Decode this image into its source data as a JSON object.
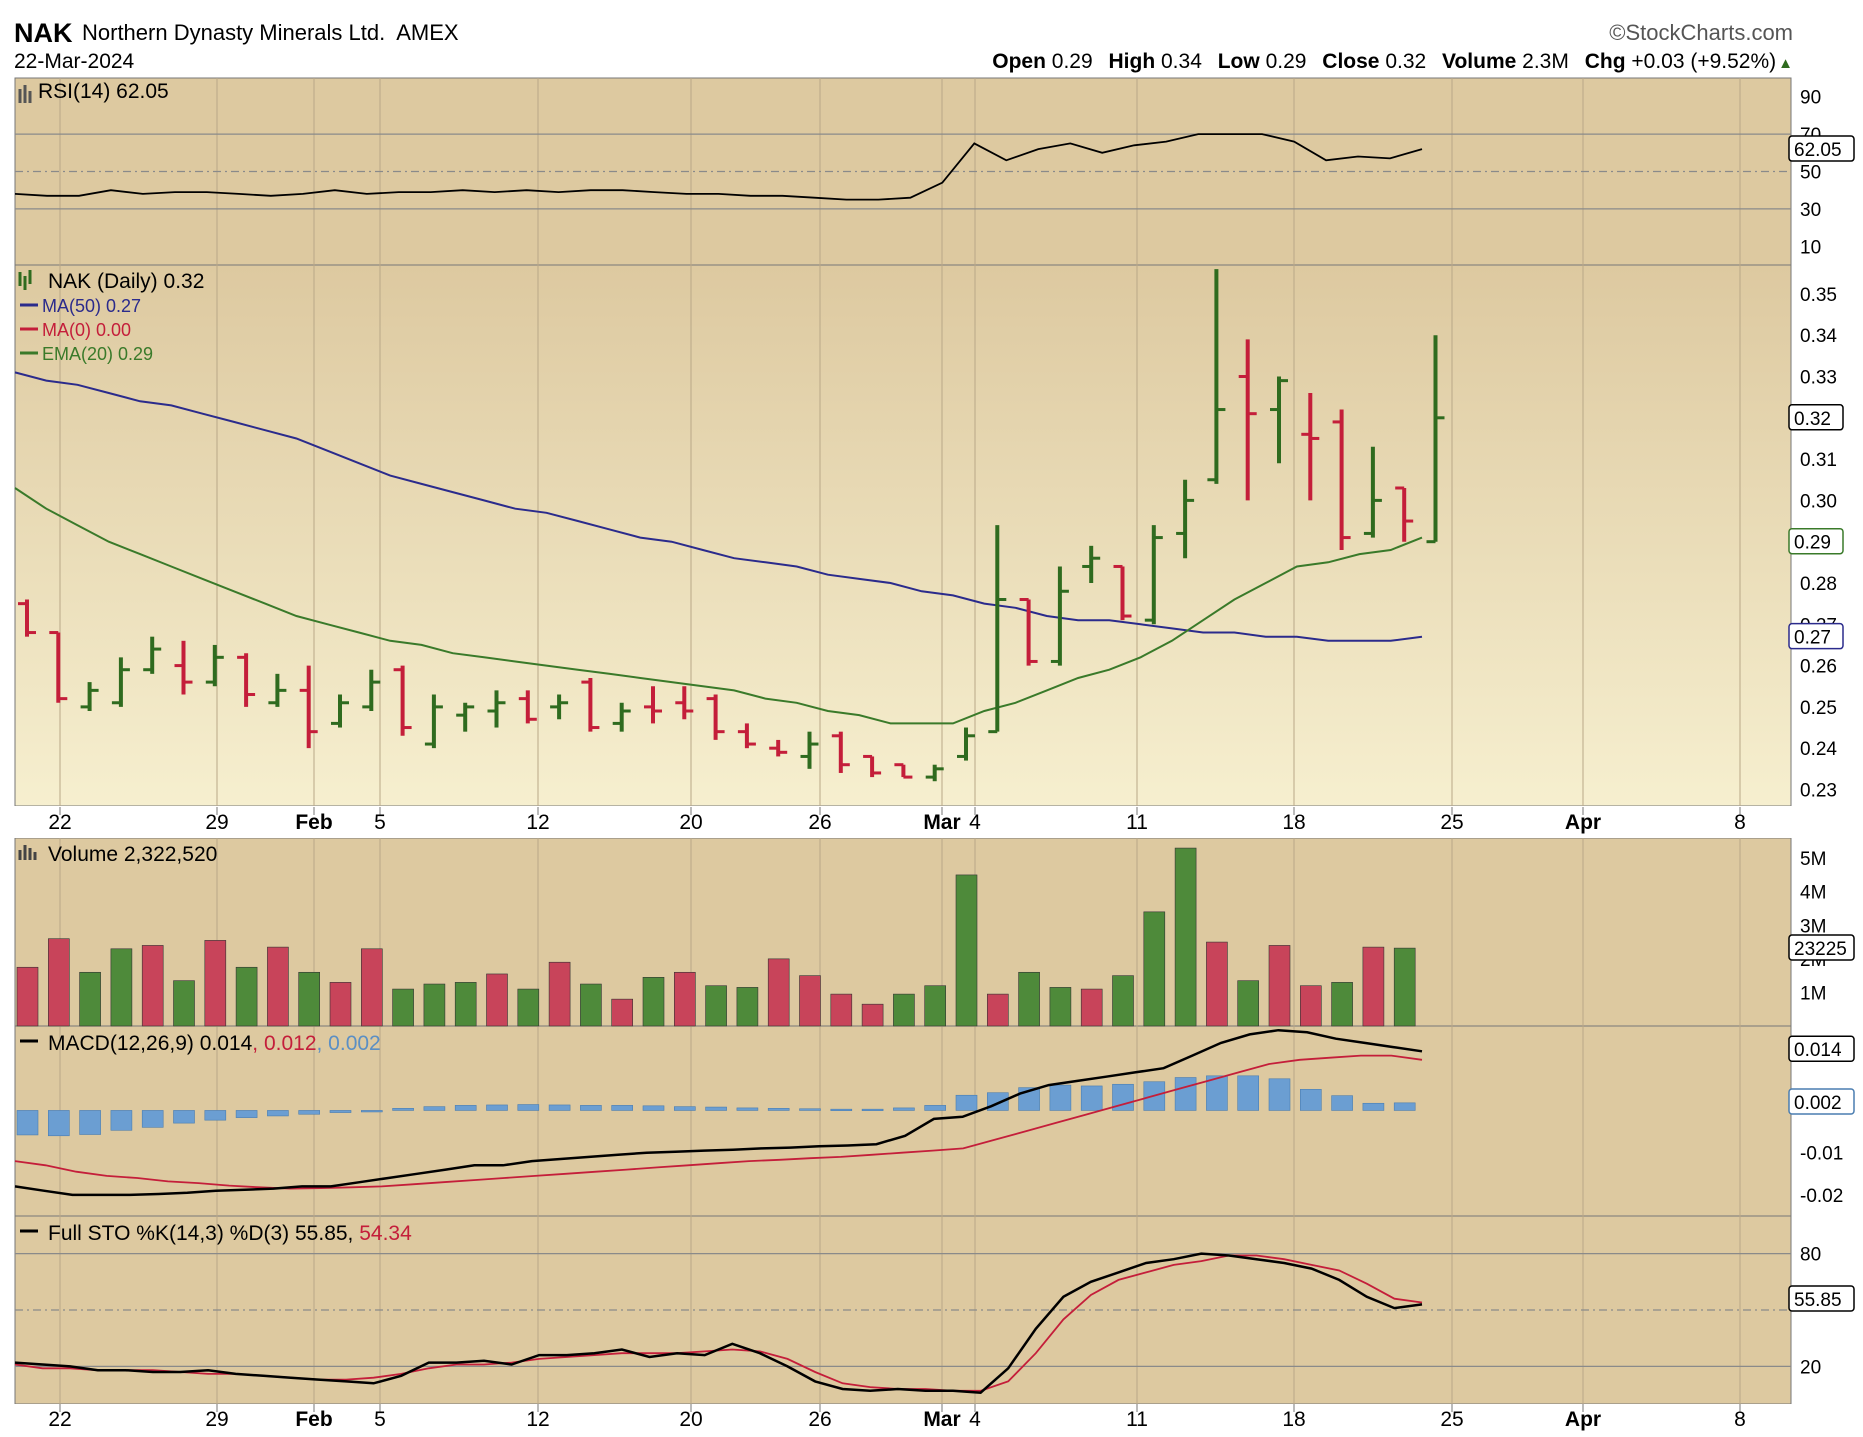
{
  "header": {
    "symbol": "NAK",
    "company": "Northern Dynasty Minerals Ltd.",
    "exchange": "AMEX",
    "date": "22-Mar-2024",
    "source": "©StockCharts.com",
    "quote": {
      "open_label": "Open",
      "open": "0.29",
      "high_label": "High",
      "high": "0.34",
      "low_label": "Low",
      "low": "0.29",
      "close_label": "Close",
      "close": "0.32",
      "volume_label": "Volume",
      "volume": "2.3M",
      "chg_label": "Chg",
      "chg": "+0.03 (+9.52%)",
      "up_arrow": "▲"
    }
  },
  "colors": {
    "up": "#2f6b1f",
    "down": "#c41e3a",
    "ma50": "#2b2b8c",
    "ema20": "#3a7a2a",
    "volume_up": "#4e8a3a",
    "volume_down": "#c8445a",
    "macd_hist": "#6b9ed2",
    "panel_bg": "#ddc9a0",
    "panel_bg_light": "#f6efcf"
  },
  "chart_data": [
    {
      "type": "line",
      "panel": "rsi",
      "legend": "RSI(14) 62.05",
      "last_value_label": "62.05",
      "ylim": [
        0,
        100
      ],
      "yticks": [
        10,
        30,
        50,
        70,
        90
      ],
      "reference_lines": [
        30,
        70
      ],
      "series": [
        {
          "values": [
            38,
            37,
            37,
            40,
            38,
            39,
            39,
            38,
            37,
            38,
            40,
            38,
            39,
            39,
            40,
            39,
            40,
            39,
            40,
            40,
            39,
            38,
            38,
            37,
            37,
            36,
            35,
            35,
            36,
            44,
            65,
            56,
            62,
            65,
            60,
            64,
            66,
            70,
            70,
            70,
            66,
            56,
            58,
            57,
            62
          ]
        }
      ]
    },
    {
      "type": "bar",
      "panel": "price",
      "legend_price": "NAK (Daily) 0.32",
      "legend_ma50": "MA(50) 0.27",
      "legend_ma0": "MA(0) 0.00",
      "legend_ema20": "EMA(20) 0.29",
      "price_label": "0.32",
      "ema_label": "0.29",
      "ma50_label": "0.27",
      "ylim": [
        0.226,
        0.357
      ],
      "yticks": [
        "0.23",
        "0.24",
        "0.25",
        "0.26",
        "0.27",
        "0.28",
        "0.29",
        "0.30",
        "0.31",
        "0.32",
        "0.33",
        "0.34",
        "0.35"
      ],
      "x_ticks": [
        {
          "label": "22",
          "bold": false
        },
        {
          "label": "29",
          "bold": false
        },
        {
          "label": "Feb",
          "bold": true
        },
        {
          "label": "5",
          "bold": false
        },
        {
          "label": "12",
          "bold": false
        },
        {
          "label": "20",
          "bold": false
        },
        {
          "label": "26",
          "bold": false
        },
        {
          "label": "Mar",
          "bold": true
        },
        {
          "label": "4",
          "bold": false
        },
        {
          "label": "11",
          "bold": false
        },
        {
          "label": "18",
          "bold": false
        },
        {
          "label": "25",
          "bold": false
        },
        {
          "label": "Apr",
          "bold": true
        },
        {
          "label": "8",
          "bold": false
        }
      ],
      "ohlc": [
        [
          0.275,
          0.276,
          0.267,
          0.268
        ],
        [
          0.268,
          0.268,
          0.251,
          0.252
        ],
        [
          0.25,
          0.256,
          0.249,
          0.254
        ],
        [
          0.251,
          0.262,
          0.25,
          0.259
        ],
        [
          0.259,
          0.267,
          0.258,
          0.264
        ],
        [
          0.26,
          0.266,
          0.253,
          0.256
        ],
        [
          0.256,
          0.265,
          0.255,
          0.262
        ],
        [
          0.262,
          0.263,
          0.25,
          0.253
        ],
        [
          0.251,
          0.258,
          0.25,
          0.254
        ],
        [
          0.254,
          0.26,
          0.24,
          0.244
        ],
        [
          0.246,
          0.253,
          0.245,
          0.251
        ],
        [
          0.25,
          0.259,
          0.249,
          0.256
        ],
        [
          0.259,
          0.26,
          0.243,
          0.245
        ],
        [
          0.241,
          0.253,
          0.24,
          0.25
        ],
        [
          0.248,
          0.251,
          0.244,
          0.25
        ],
        [
          0.249,
          0.254,
          0.245,
          0.251
        ],
        [
          0.252,
          0.254,
          0.246,
          0.247
        ],
        [
          0.25,
          0.253,
          0.247,
          0.251
        ],
        [
          0.256,
          0.257,
          0.244,
          0.245
        ],
        [
          0.246,
          0.251,
          0.244,
          0.249
        ],
        [
          0.25,
          0.255,
          0.246,
          0.249
        ],
        [
          0.251,
          0.255,
          0.247,
          0.249
        ],
        [
          0.252,
          0.253,
          0.242,
          0.244
        ],
        [
          0.244,
          0.246,
          0.24,
          0.241
        ],
        [
          0.24,
          0.242,
          0.238,
          0.239
        ],
        [
          0.238,
          0.244,
          0.235,
          0.241
        ],
        [
          0.243,
          0.244,
          0.234,
          0.236
        ],
        [
          0.238,
          0.238,
          0.233,
          0.234
        ],
        [
          0.236,
          0.236,
          0.233,
          0.233
        ],
        [
          0.233,
          0.236,
          0.232,
          0.235
        ],
        [
          0.238,
          0.245,
          0.237,
          0.243
        ],
        [
          0.244,
          0.294,
          0.244,
          0.276
        ],
        [
          0.276,
          0.276,
          0.26,
          0.261
        ],
        [
          0.261,
          0.284,
          0.26,
          0.278
        ],
        [
          0.284,
          0.289,
          0.28,
          0.286
        ],
        [
          0.284,
          0.284,
          0.271,
          0.272
        ],
        [
          0.271,
          0.294,
          0.27,
          0.291
        ],
        [
          0.292,
          0.305,
          0.286,
          0.3
        ],
        [
          0.305,
          0.356,
          0.304,
          0.322
        ],
        [
          0.33,
          0.339,
          0.3,
          0.321
        ],
        [
          0.322,
          0.33,
          0.309,
          0.329
        ],
        [
          0.316,
          0.326,
          0.3,
          0.315
        ],
        [
          0.319,
          0.322,
          0.288,
          0.291
        ],
        [
          0.292,
          0.313,
          0.291,
          0.3
        ],
        [
          0.303,
          0.303,
          0.29,
          0.295
        ],
        [
          0.29,
          0.34,
          0.29,
          0.32
        ]
      ],
      "ema20": [
        0.303,
        0.298,
        0.294,
        0.29,
        0.287,
        0.284,
        0.281,
        0.278,
        0.275,
        0.272,
        0.27,
        0.268,
        0.266,
        0.265,
        0.263,
        0.262,
        0.261,
        0.26,
        0.259,
        0.258,
        0.257,
        0.256,
        0.255,
        0.254,
        0.252,
        0.251,
        0.249,
        0.248,
        0.246,
        0.246,
        0.246,
        0.249,
        0.251,
        0.254,
        0.257,
        0.259,
        0.262,
        0.266,
        0.271,
        0.276,
        0.28,
        0.284,
        0.285,
        0.287,
        0.288,
        0.291
      ],
      "ma50": [
        0.331,
        0.329,
        0.328,
        0.326,
        0.324,
        0.323,
        0.321,
        0.319,
        0.317,
        0.315,
        0.312,
        0.309,
        0.306,
        0.304,
        0.302,
        0.3,
        0.298,
        0.297,
        0.295,
        0.293,
        0.291,
        0.29,
        0.288,
        0.286,
        0.285,
        0.284,
        0.282,
        0.281,
        0.28,
        0.278,
        0.277,
        0.275,
        0.274,
        0.272,
        0.271,
        0.271,
        0.27,
        0.269,
        0.268,
        0.268,
        0.267,
        0.267,
        0.266,
        0.266,
        0.266,
        0.267
      ]
    },
    {
      "type": "bar",
      "panel": "volume",
      "legend": "Volume 2,322,520",
      "last_value_label": "23225",
      "ylim": [
        0,
        5600000
      ],
      "yticks": [
        {
          "v": 1000000,
          "label": "1M"
        },
        {
          "v": 2000000,
          "label": "2M"
        },
        {
          "v": 3000000,
          "label": "3M"
        },
        {
          "v": 4000000,
          "label": "4M"
        },
        {
          "v": 5000000,
          "label": "5M"
        }
      ],
      "values": [
        1.75,
        2.6,
        1.6,
        2.3,
        2.4,
        1.35,
        2.55,
        1.75,
        2.35,
        1.6,
        1.3,
        2.3,
        1.1,
        1.25,
        1.3,
        1.55,
        1.1,
        1.9,
        1.25,
        0.8,
        1.45,
        1.6,
        1.2,
        1.15,
        2.0,
        1.5,
        0.95,
        0.65,
        0.95,
        1.2,
        4.5,
        0.95,
        1.6,
        1.15,
        1.1,
        1.5,
        3.4,
        5.3,
        2.5,
        1.35,
        2.4,
        1.2,
        1.3,
        2.35,
        2.32
      ],
      "up": [
        false,
        false,
        true,
        true,
        false,
        true,
        false,
        true,
        false,
        true,
        false,
        false,
        true,
        true,
        true,
        false,
        true,
        false,
        true,
        false,
        true,
        false,
        true,
        true,
        false,
        false,
        false,
        false,
        true,
        true,
        true,
        false,
        true,
        true,
        false,
        true,
        true,
        true,
        false,
        true,
        false,
        false,
        true,
        false,
        true
      ]
    },
    {
      "type": "line",
      "panel": "macd",
      "legend_prefix": "MACD(12,26,9) 0.014",
      "legend_signal": "0.012",
      "legend_hist": "0.002",
      "label_macd": "0.014",
      "label_hist": "0.002",
      "ylim": [
        -0.025,
        0.02
      ],
      "yticks": [
        {
          "v": -0.01,
          "label": "-0.01"
        },
        {
          "v": -0.02,
          "label": "-0.02"
        }
      ],
      "macd": [
        -0.018,
        -0.019,
        -0.02,
        -0.02,
        -0.02,
        -0.0198,
        -0.0195,
        -0.019,
        -0.0188,
        -0.0185,
        -0.018,
        -0.018,
        -0.017,
        -0.016,
        -0.015,
        -0.014,
        -0.013,
        -0.013,
        -0.012,
        -0.0115,
        -0.011,
        -0.0105,
        -0.01,
        -0.0098,
        -0.0095,
        -0.0093,
        -0.009,
        -0.0088,
        -0.0085,
        -0.0083,
        -0.008,
        -0.006,
        -0.002,
        -0.0015,
        0.001,
        0.004,
        0.006,
        0.007,
        0.008,
        0.009,
        0.01,
        0.013,
        0.016,
        0.018,
        0.019,
        0.0185,
        0.017,
        0.016,
        0.015,
        0.014
      ],
      "signal": [
        -0.012,
        -0.013,
        -0.0145,
        -0.0155,
        -0.016,
        -0.0168,
        -0.0172,
        -0.0178,
        -0.0182,
        -0.0185,
        -0.0184,
        -0.0182,
        -0.018,
        -0.0175,
        -0.017,
        -0.0165,
        -0.016,
        -0.0155,
        -0.015,
        -0.0145,
        -0.014,
        -0.0135,
        -0.013,
        -0.0125,
        -0.012,
        -0.0117,
        -0.0113,
        -0.011,
        -0.0105,
        -0.01,
        -0.0095,
        -0.009,
        -0.007,
        -0.005,
        -0.003,
        -0.001,
        0.001,
        0.003,
        0.005,
        0.007,
        0.009,
        0.011,
        0.012,
        0.0125,
        0.013,
        0.013,
        0.012
      ],
      "hist": [
        -0.0058,
        -0.006,
        -0.0057,
        -0.0047,
        -0.004,
        -0.003,
        -0.0023,
        -0.0017,
        -0.0013,
        -0.0009,
        -0.0005,
        -0.0002,
        0.0005,
        0.0009,
        0.0012,
        0.0013,
        0.0014,
        0.0013,
        0.0012,
        0.0012,
        0.0011,
        0.0009,
        0.0008,
        0.0006,
        0.0005,
        0.0004,
        0.0003,
        0.0003,
        0.0006,
        0.0012,
        0.0036,
        0.0042,
        0.0054,
        0.006,
        0.0058,
        0.0062,
        0.0068,
        0.0078,
        0.0082,
        0.0082,
        0.0075,
        0.005,
        0.0035,
        0.0017,
        0.0018
      ]
    },
    {
      "type": "line",
      "panel": "stochastic",
      "legend_prefix": "Full STO %K(14,3) %D(3) 55.85,",
      "legend_d": "54.34",
      "last_value_label": "55.85",
      "ylim": [
        0,
        100
      ],
      "yticks": [
        {
          "v": 20,
          "label": "20"
        },
        {
          "v": 80,
          "label": "80"
        }
      ],
      "reference_lines": [
        20,
        80
      ],
      "k": [
        22,
        21,
        20,
        18,
        18,
        17,
        17,
        18,
        16,
        15,
        14,
        13,
        12,
        11,
        15,
        22,
        22,
        23,
        21,
        26,
        26,
        27,
        29,
        25,
        27,
        26,
        32,
        27,
        20,
        12,
        8,
        7,
        8,
        7,
        7,
        6,
        19,
        40,
        57,
        65,
        70,
        75,
        77,
        80,
        79,
        77,
        75,
        72,
        66,
        57,
        51,
        53
      ],
      "d": [
        21,
        19,
        19,
        18,
        18,
        18,
        17,
        16,
        16,
        15,
        14,
        13,
        13,
        14,
        16,
        19,
        21,
        21,
        22,
        24,
        25,
        26,
        27,
        27,
        27,
        28,
        29,
        28,
        24,
        17,
        11,
        9,
        8,
        8,
        7,
        7,
        12,
        27,
        45,
        58,
        66,
        70,
        74,
        76,
        79,
        79,
        77,
        74,
        71,
        64,
        56,
        54
      ]
    }
  ]
}
